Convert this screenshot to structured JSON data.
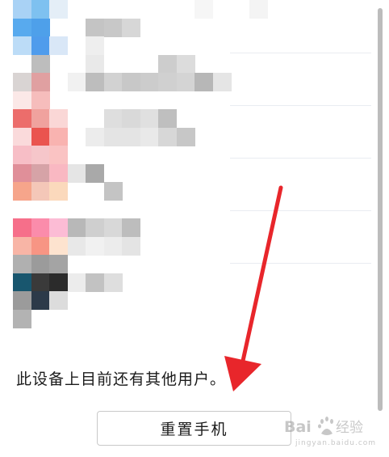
{
  "info": {
    "text": "此设备上目前还有其他用户。"
  },
  "reset_button": {
    "label": "重置手机"
  },
  "watermark": {
    "domain": "jingyan.baidu.com"
  },
  "colors": {
    "arrow": "#e8262b",
    "text": "#1b1b1b",
    "button_border": "#c9c9c9",
    "scrollbar": "#bcbcbc"
  }
}
